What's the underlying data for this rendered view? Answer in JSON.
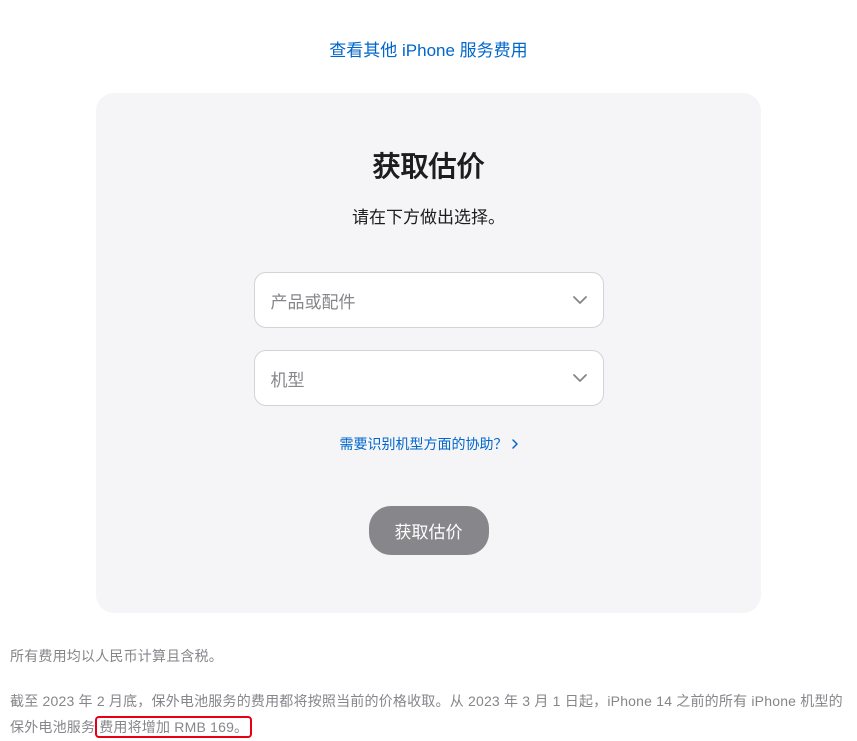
{
  "topLink": {
    "label": "查看其他 iPhone 服务费用"
  },
  "card": {
    "title": "获取估价",
    "subtitle": "请在下方做出选择。",
    "select1": {
      "placeholder": "产品或配件"
    },
    "select2": {
      "placeholder": "机型"
    },
    "helpLink": {
      "label": "需要识别机型方面的协助？"
    },
    "submit": {
      "label": "获取估价"
    }
  },
  "footer": {
    "line1": "所有费用均以人民币计算且含税。",
    "line2a": "截至 2023 年 2 月底，保外电池服务的费用都将按照当前的价格收取。从 2023 年 3 月 1 日起，iPhone 14 之前的所有 iPhone 机型的保外电池服务",
    "line2b": "费用将增加 RMB 169。"
  }
}
